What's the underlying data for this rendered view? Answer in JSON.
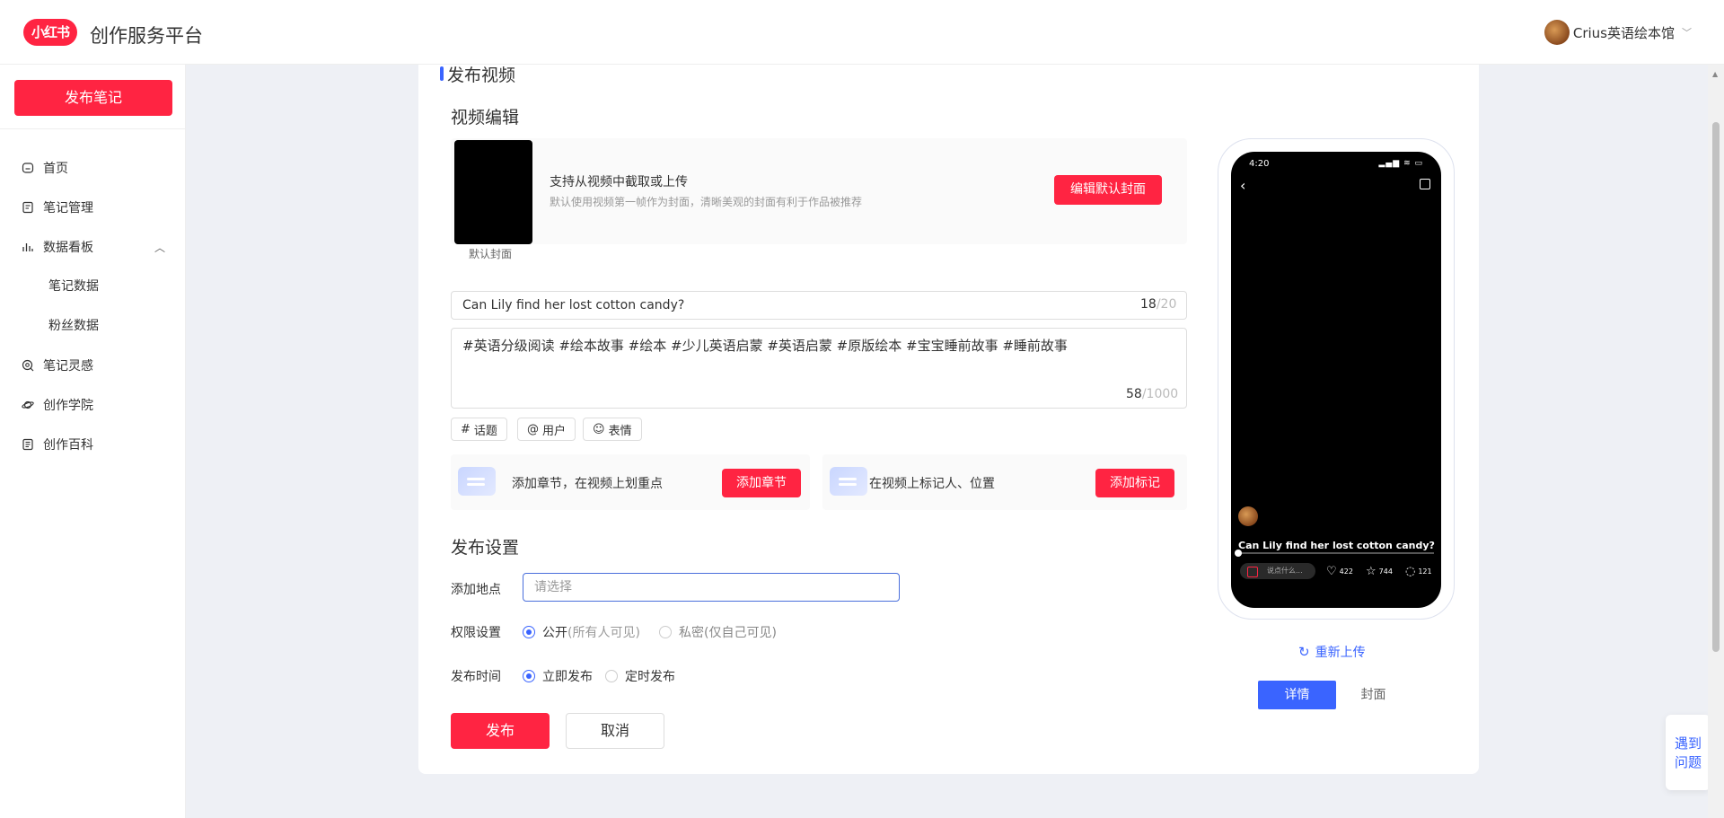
{
  "header": {
    "logo_text": "小红书",
    "app_title": "创作服务平台",
    "user_name": "Crius英语绘本馆"
  },
  "sidebar": {
    "publish_button": "发布笔记",
    "items": [
      {
        "label": "首页",
        "icon": "home-icon"
      },
      {
        "label": "笔记管理",
        "icon": "note-icon"
      },
      {
        "label": "数据看板",
        "icon": "chart-icon"
      },
      {
        "label": "笔记灵感",
        "icon": "inspiration-icon"
      },
      {
        "label": "创作学院",
        "icon": "academy-icon"
      },
      {
        "label": "创作百科",
        "icon": "wiki-icon"
      }
    ],
    "sub_items": [
      "笔记数据",
      "粉丝数据"
    ]
  },
  "main": {
    "section_title": "发布视频",
    "video_edit_title": "视频编辑",
    "cover": {
      "label": "默认封面",
      "title": "支持从视频中截取或上传",
      "hint": "默认使用视频第一帧作为封面，清晰美观的封面有利于作品被推荐",
      "edit_button": "编辑默认封面"
    },
    "title_input": {
      "value": "Can Lily find her lost cotton candy?",
      "count": "18",
      "max": "/20"
    },
    "description": {
      "value": "#英语分级阅读  #绘本故事  #绘本  #少儿英语启蒙  #英语启蒙  #原版绘本  #宝宝睡前故事  #睡前故事",
      "count": "58",
      "max": "/1000"
    },
    "tools": {
      "topic": "话题",
      "user": "用户",
      "emoji": "表情"
    },
    "chapters": {
      "text": "添加章节，在视频上划重点",
      "button": "添加章节"
    },
    "marks": {
      "text": "在视频上标记人、位置",
      "button": "添加标记"
    },
    "settings": {
      "title": "发布设置",
      "location_label": "添加地点",
      "location_placeholder": "请选择",
      "permission_label": "权限设置",
      "public": "公开",
      "public_hint": "(所有人可见)",
      "private": "私密(仅自己可见)",
      "time_label": "发布时间",
      "now": "立即发布",
      "scheduled": "定时发布"
    },
    "publish_button": "发布",
    "cancel_button": "取消"
  },
  "preview": {
    "status_time": "4:20",
    "status_icons": "▂▄▆ ≋ ▭",
    "title": "Can Lily find her lost cotton candy? #英",
    "comment_placeholder": "说点什么...",
    "likes": "422",
    "collects": "744",
    "comments": "121",
    "reupload": "重新上传",
    "tab_detail": "详情",
    "tab_cover": "封面"
  },
  "help": {
    "line1": "遇到",
    "line2": "问题"
  },
  "colors": {
    "brand": "#ff2442",
    "accent": "#3a64ff"
  }
}
